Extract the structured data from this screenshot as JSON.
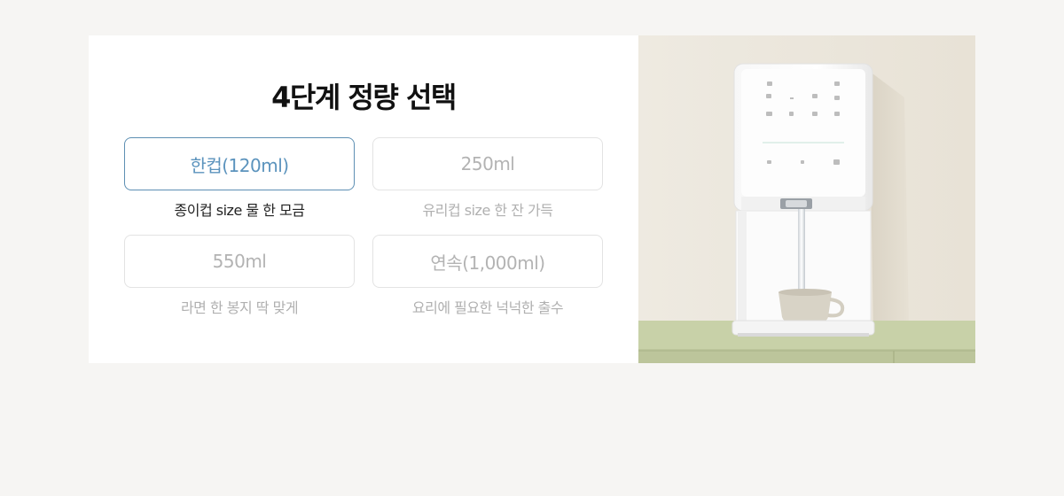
{
  "section": {
    "title": "4단계 정량 선택"
  },
  "options": [
    {
      "label": "한컵(120ml)",
      "description": "종이컵 size 물 한 모금",
      "selected": true
    },
    {
      "label": "250ml",
      "description": "유리컵 size 한 잔 가득",
      "selected": false
    },
    {
      "label": "550ml",
      "description": "라면 한 봉지 딱 맞게",
      "selected": false
    },
    {
      "label": "연속(1,000ml)",
      "description": "요리에 필요한 넉넉한 출수",
      "selected": false
    }
  ],
  "colors": {
    "page_bg": "#f6f5f3",
    "panel_bg": "#ffffff",
    "accent": "#5b93bd",
    "inactive_text": "#b3b3b3",
    "countertop": "#c7d0a5"
  }
}
